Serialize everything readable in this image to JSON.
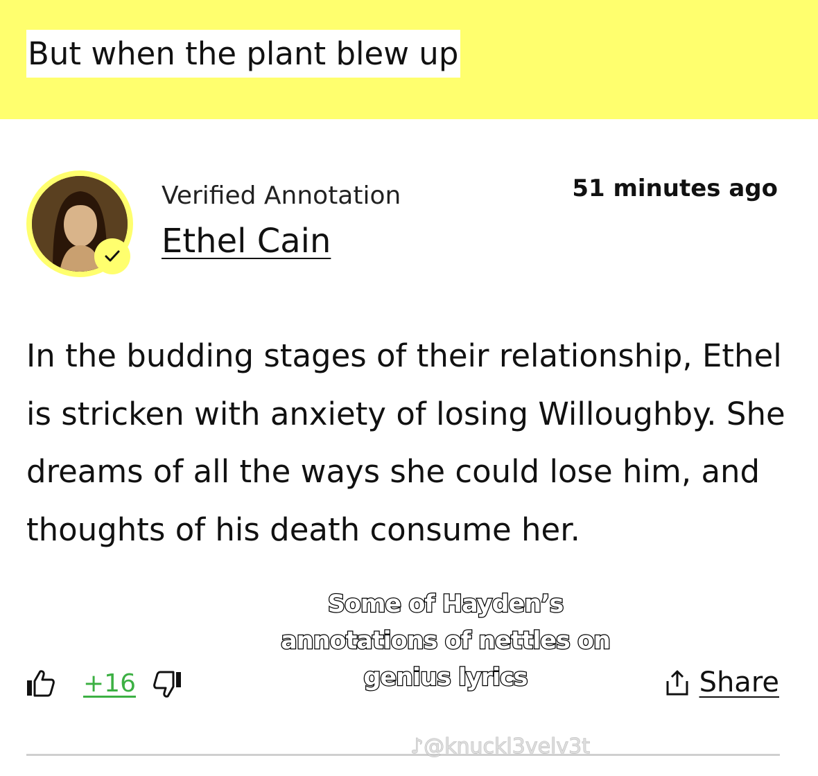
{
  "lyric": {
    "text": "But when the plant blew up"
  },
  "annotation": {
    "verified_label": "Verified Annotation",
    "author": "Ethel Cain",
    "timestamp": "51 minutes ago",
    "body": "In the budding stages of their relationship, Ethel is stricken with anxiety of losing Willoughby. She dreams of all the ways she could lose him, and thoughts of his death consume her."
  },
  "actions": {
    "vote_count": "+16",
    "share_label": "Share"
  },
  "overlay": {
    "caption": "Some of Hayden’s annotations of nettles on genius lyrics",
    "watermark": "@knuckl3velv3t"
  },
  "colors": {
    "brand_yellow": "#ffff6e",
    "vote_green": "#3cb043"
  },
  "icons": [
    "thumbs-up-icon",
    "thumbs-down-icon",
    "share-icon",
    "checkmark-icon",
    "tiktok-icon"
  ]
}
